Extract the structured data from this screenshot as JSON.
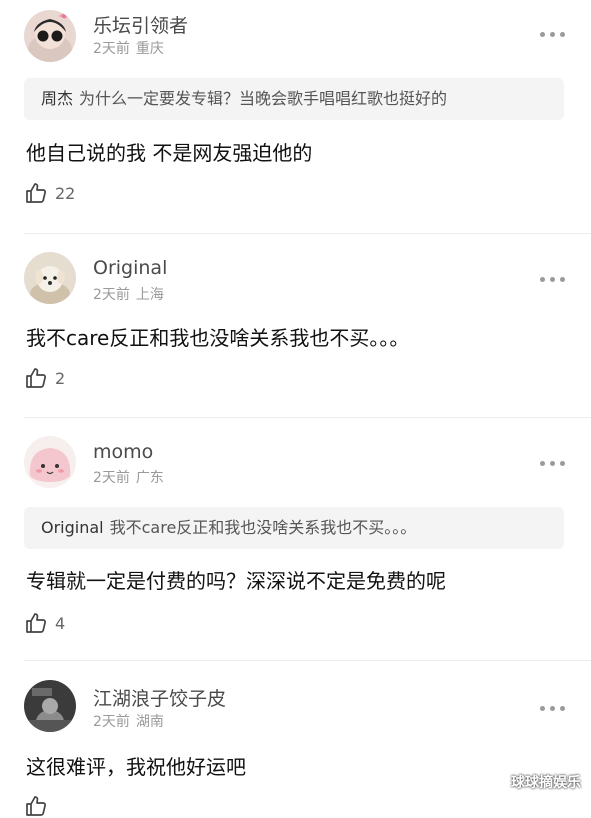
{
  "comments": [
    {
      "name": "乐坛引领者",
      "time": "2天前",
      "location": "重庆",
      "quote": {
        "name": "周杰",
        "text": "为什么一定要发专辑？当晚会歌手唱唱红歌也挺好的"
      },
      "text": "他自己说的我 不是网友强迫他的",
      "likes": "22",
      "avatar": "girl-with-pink-bow"
    },
    {
      "name": "Original",
      "time": "2天前",
      "location": "上海",
      "text": "我不care反正和我也没啥关系我也不买。。。",
      "likes": "2",
      "avatar": "puppy"
    },
    {
      "name": "momo",
      "time": "2天前",
      "location": "广东",
      "quote": {
        "name": "Original",
        "text": "我不care反正和我也没啥关系我也不买。。。"
      },
      "text": "专辑就一定是付费的吗？深深说不定是免费的呢",
      "likes": "4",
      "avatar": "pink-blob"
    },
    {
      "name": "江湖浪子饺子皮",
      "time": "2天前",
      "location": "湖南",
      "text": "这很难评，我祝他好运吧",
      "avatar": "photo"
    }
  ],
  "watermark": "球球摘娱乐",
  "colors": {
    "meta": "#9a9a9a",
    "quote_bg": "#f4f4f4",
    "divider": "#ececec"
  }
}
